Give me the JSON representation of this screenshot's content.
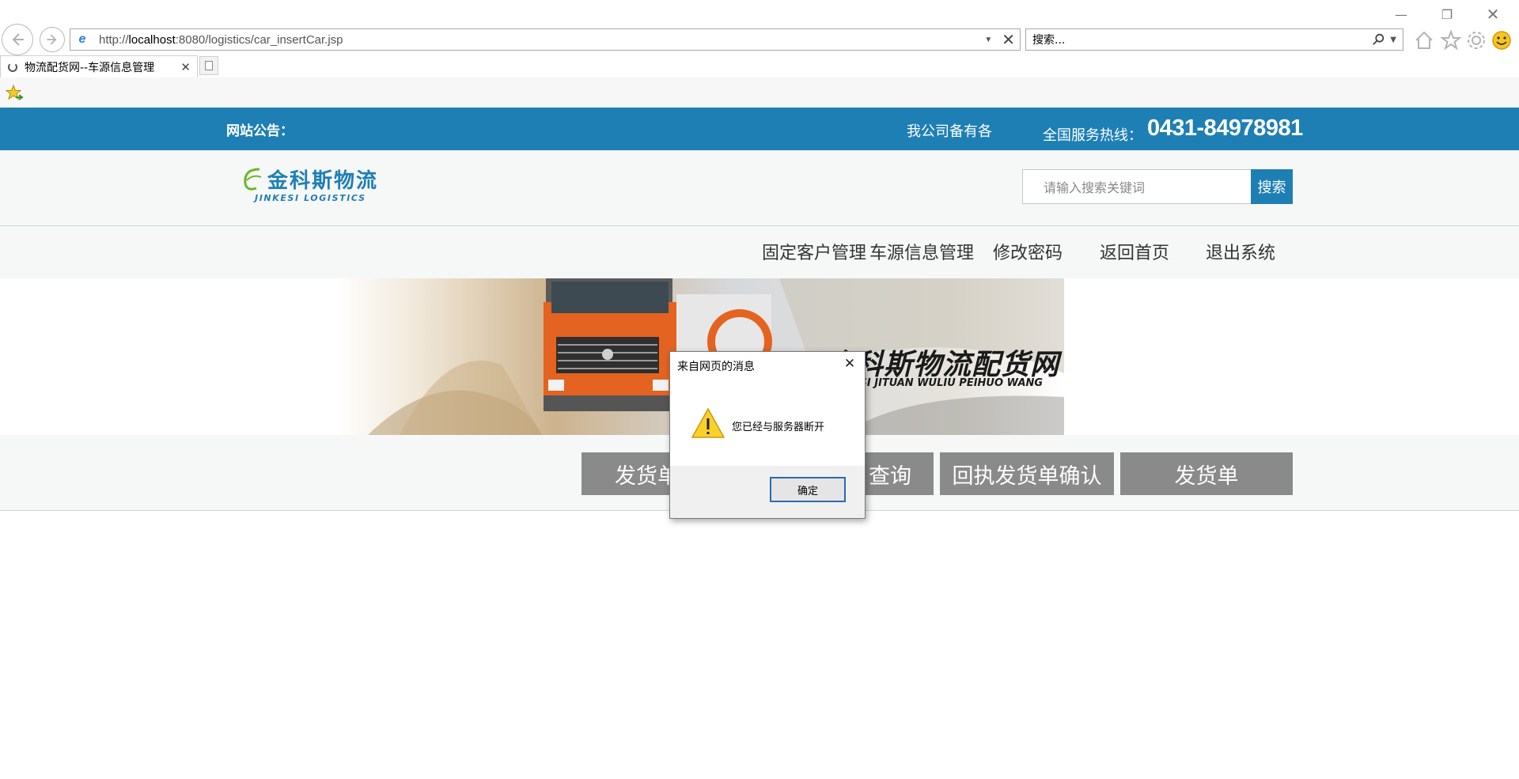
{
  "browser": {
    "url_prefix": "http://",
    "url_host": "localhost",
    "url_rest": ":8080/logistics/car_insertCar.jsp",
    "search_placeholder": "搜索...",
    "tab_title": "物流配货网--车源信息管理",
    "icons": [
      "back-icon",
      "forward-icon",
      "ie-logo-icon",
      "dropdown-icon",
      "stop-icon",
      "search-icon",
      "home-icon",
      "favorites-star-icon",
      "settings-gear-icon",
      "smiley-feedback-icon",
      "add-favorites-icon",
      "minimize-icon",
      "restore-icon",
      "close-icon",
      "loading-spinner-icon"
    ]
  },
  "topbar": {
    "notice_label": "网站公告：",
    "notice_text": "我公司备有各",
    "hotline_label": "全国服务热线：",
    "hotline_number": "0431-84978981",
    "bg_color": "#1e7fb5"
  },
  "logo": {
    "cn": "金科斯物流",
    "en": "JINKESI LOGISTICS"
  },
  "site_search": {
    "placeholder": "请输入搜索关键词",
    "button_label": "搜索"
  },
  "menu": {
    "items": [
      "固定客户管理",
      "车源信息管理",
      "修改密码",
      "返回首页",
      "退出系统"
    ]
  },
  "banner": {
    "title_cn": "金科斯物流配货网",
    "title_en": "JINKESI JITUAN WULIU PEIHUO WANG"
  },
  "action_buttons": {
    "items": [
      "发货单",
      "查询",
      "回执发货单确认",
      "发货单"
    ]
  },
  "dialog": {
    "title": "来自网页的消息",
    "message": "您已经与服务器断开",
    "ok_label": "确定",
    "icon": "warning-icon"
  }
}
